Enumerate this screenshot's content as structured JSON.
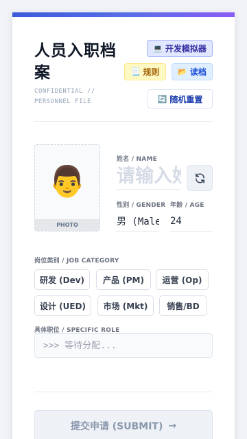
{
  "header": {
    "title": "人员入职档案",
    "subtitle": "CONFIDENTIAL // PERSONNEL FILE"
  },
  "toolbar": {
    "dev_icon": "💻",
    "dev_label": "开发模拟器",
    "rules_icon": "📃",
    "rules_label": "规则",
    "load_icon": "📂",
    "load_label": "读档",
    "reset_icon": "🔄",
    "reset_label": "随机重置"
  },
  "photo": {
    "avatar": "👨",
    "label": "PHOTO"
  },
  "form": {
    "name_label": "姓名 / NAME",
    "name_placeholder": "请输入姓名",
    "gender_label": "性别 / GENDER",
    "gender_value": "男 (Male)",
    "age_label": "年龄 / AGE",
    "age_value": "24",
    "job_category_label": "岗位类别 / JOB CATEGORY",
    "job_categories": [
      "研发 (Dev)",
      "产品 (PM)",
      "运营 (Op)",
      "设计 (UED)",
      "市场 (Mkt)",
      "销售/BD"
    ],
    "role_label": "具体职位 / SPECIFIC ROLE",
    "role_placeholder": ">>> 等待分配..."
  },
  "submit": {
    "label": "提交申请 (SUBMIT)",
    "arrow": "→"
  },
  "colors": {
    "accent": "#3b5bdb",
    "gradient_end": "#8b5cf6"
  }
}
